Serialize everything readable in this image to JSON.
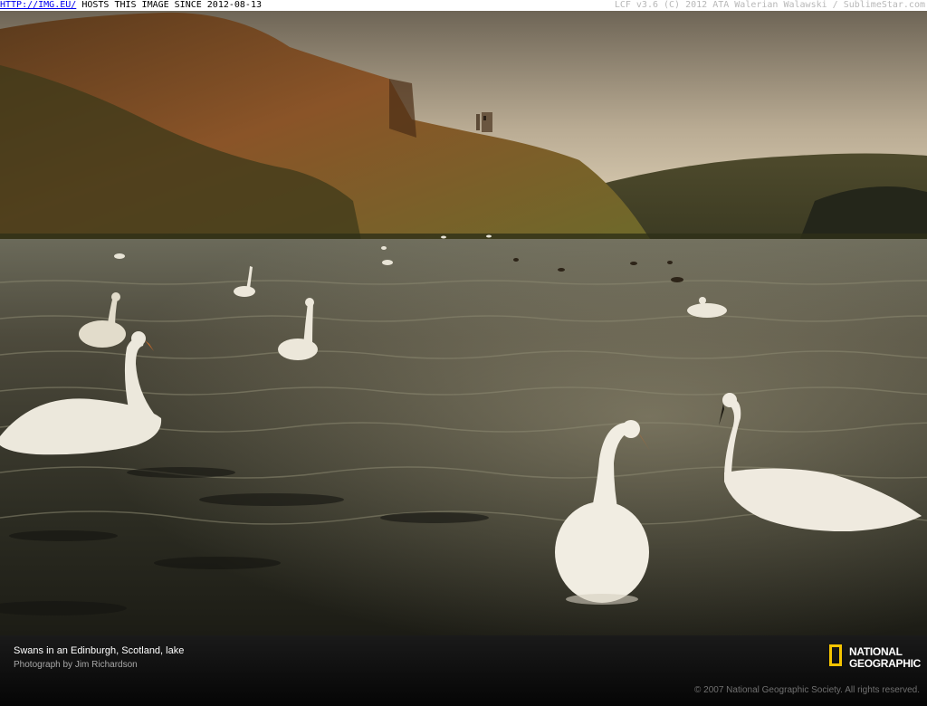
{
  "watermark": {
    "link": "HTTP://IMG.EU/",
    "text": " HOSTS THIS IMAGE SINCE 2012-08-13",
    "right": "LCF v3.6 (C) 2012 ATA Walerian Walawski / SublimeStar.com"
  },
  "caption": {
    "title": "Swans in an Edinburgh, Scotland, lake",
    "credit": "Photograph by Jim Richardson",
    "copyright": "© 2007 National Geographic Society. All rights reserved."
  },
  "logo": {
    "line1": "NATIONAL",
    "line2": "GEOGRAPHIC",
    "accent": "#f5c400"
  }
}
